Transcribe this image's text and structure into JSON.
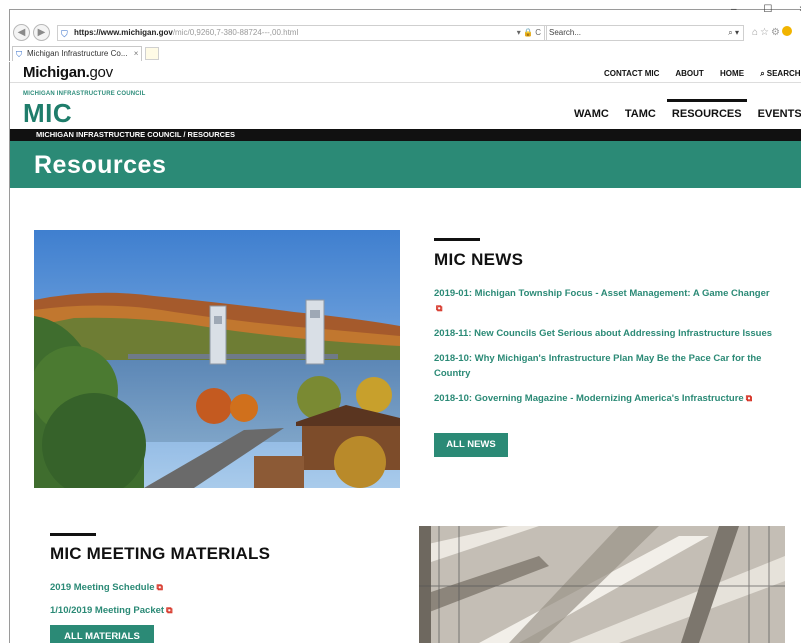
{
  "browser": {
    "url_protocol": "https://www.",
    "url_domain": "michigan.gov",
    "url_path": "/mic/0,9260,7-380-88724---,00.html",
    "url_controls": "▾ 🔒 C",
    "search_placeholder": "Search...",
    "tab_title": "Michigan Infrastructure Co...",
    "tab_close": "×",
    "window_controls": "–  ☐  ×"
  },
  "site": {
    "logo_bold": "Michigan.",
    "logo_light": "gov",
    "top_nav": [
      "CONTACT MIC",
      "ABOUT",
      "HOME",
      "SEARCH"
    ],
    "council_small": "MICHIGAN INFRASTRUCTURE COUNCIL",
    "council_big": "MIC",
    "main_nav": [
      "WAMC",
      "TAMC",
      "RESOURCES",
      "EVENTS"
    ],
    "active_nav": "RESOURCES",
    "breadcrumb": "MICHIGAN INFRASTRUCTURE COUNCIL  /  RESOURCES",
    "page_title": "Resources"
  },
  "news": {
    "title": "MIC NEWS",
    "items": [
      "2019-01: Michigan Township Focus - Asset Management: A Game Changer",
      "2018-11: New Councils Get Serious about Addressing Infrastructure Issues",
      "2018-10: Why Michigan's Infrastructure Plan May Be the Pace Car for the Country",
      "2018-10: Governing Magazine - Modernizing America's Infrastructure"
    ],
    "button": "ALL NEWS"
  },
  "materials": {
    "title": "MIC MEETING MATERIALS",
    "items": [
      "2019 Meeting Schedule",
      "1/10/2019 Meeting Packet"
    ],
    "button": "ALL MATERIALS"
  },
  "colors": {
    "teal": "#2b8a76",
    "pdf_red": "#d42a1c"
  }
}
